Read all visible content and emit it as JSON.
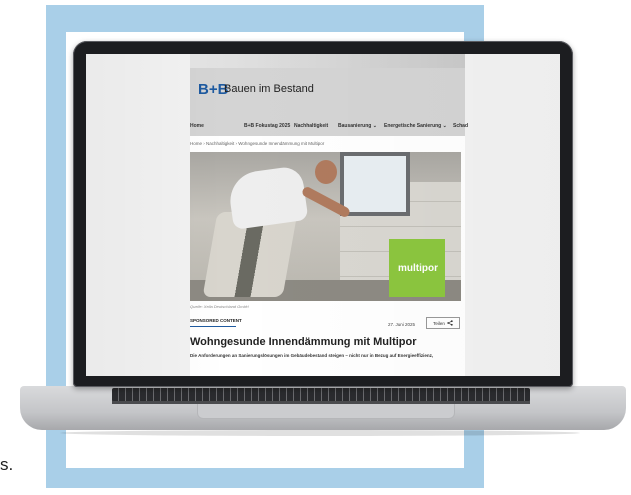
{
  "background_text": "s.",
  "site": {
    "logo_bb": "B+B",
    "logo_name": "Bauen im Bestand",
    "nav": {
      "home": "Home",
      "fokustag": "B+B Fokustag 2025",
      "nachhaltigkeit": "Nachhaltigkeit",
      "bausanierung": "Bausanierung",
      "energetische": "Energetische Sanierung",
      "schad": "Schad"
    },
    "breadcrumb": "Home  ›  Nachhaltigkeit  ›  Wohngesunde Innendämmung mit Multipor",
    "hero_brand": "multipor",
    "caption": "Quelle: Xella Deutschland GmbH",
    "sponsored_label": "SPONSORED CONTENT",
    "date": "27. Juni 2025",
    "share_label": "Teilen",
    "headline": "Wohngesunde Innendämmung mit Multipor",
    "intro": "Die Anforderungen an Sanierungslösungen im Gebäudebestand steigen – nicht nur in Bezug auf Energieeffizienz,"
  },
  "colors": {
    "frame": "#a9cfe8",
    "brand_blue": "#1e5aa0",
    "brand_green": "#8cc63f"
  }
}
